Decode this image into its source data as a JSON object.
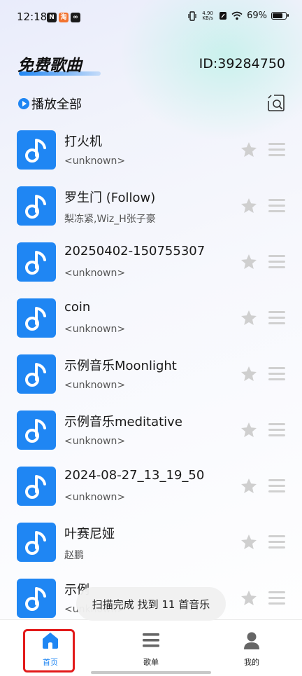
{
  "status_bar": {
    "time": "12:18",
    "net_speed_value": "4.90",
    "net_speed_unit": "KB/s",
    "battery_percent": "69%",
    "battery_level": 0.69
  },
  "header": {
    "title": "免费歌曲",
    "id_text": "ID:39284750"
  },
  "play_all": {
    "label": "播放全部"
  },
  "songs": [
    {
      "title": "打火机",
      "artist": "<unknown>"
    },
    {
      "title": "罗生门 (Follow)",
      "artist": "梨冻紧,Wiz_H张子豪"
    },
    {
      "title": "20250402-150755307",
      "artist": "<unknown>"
    },
    {
      "title": "coin",
      "artist": "<unknown>"
    },
    {
      "title": "示例音乐Moonlight",
      "artist": "<unknown>"
    },
    {
      "title": "示例音乐meditative",
      "artist": "<unknown>"
    },
    {
      "title": "2024-08-27_13_19_50",
      "artist": "<unknown>"
    },
    {
      "title": "叶赛尼娅",
      "artist": "赵鹏"
    },
    {
      "title": "示例",
      "artist": "<unknown>"
    }
  ],
  "toast": {
    "message": "扫描完成 找到 11 首音乐"
  },
  "bottom_nav": {
    "items": [
      {
        "label": "首页",
        "icon": "home-icon",
        "active": true
      },
      {
        "label": "歌单",
        "icon": "menu-icon",
        "active": false
      },
      {
        "label": "我的",
        "icon": "person-icon",
        "active": false
      }
    ]
  },
  "colors": {
    "accent": "#1f86f3",
    "highlight_box": "#e21a1a",
    "star_inactive": "#cfcfcf"
  }
}
